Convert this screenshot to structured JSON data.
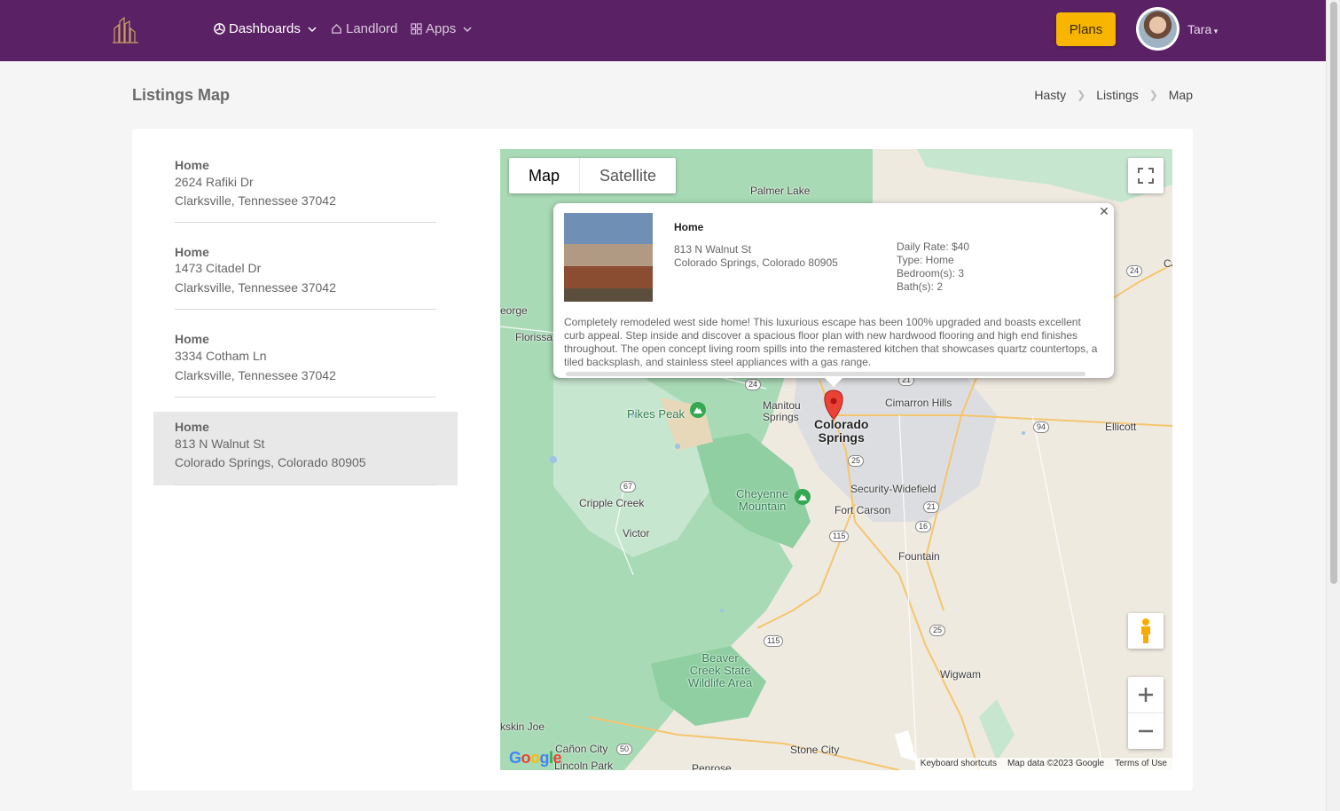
{
  "nav": {
    "dashboards": "Dashboards",
    "landlord": "Landlord",
    "apps": "Apps",
    "plans": "Plans",
    "user": "Tara"
  },
  "page": {
    "title": "Listings Map",
    "breadcrumb": [
      "Hasty",
      "Listings",
      "Map"
    ]
  },
  "listings": [
    {
      "title": "Home",
      "street": "2624 Rafiki Dr",
      "city": "Clarksville, Tennessee 37042"
    },
    {
      "title": "Home",
      "street": "1473 Citadel Dr",
      "city": "Clarksville, Tennessee 37042"
    },
    {
      "title": "Home",
      "street": "3334 Cotham Ln",
      "city": "Clarksville, Tennessee 37042"
    },
    {
      "title": "Home",
      "street": "813 N Walnut St",
      "city": "Colorado Springs, Colorado 80905"
    }
  ],
  "map": {
    "type_map": "Map",
    "type_satellite": "Satellite",
    "labels": {
      "palmer_lake": "Palmer Lake",
      "george": "eorge",
      "florissant": "Florissa",
      "pikes_peak": "Pikes Peak",
      "manitou": "Manitou\nSprings",
      "colorado_springs": "Colorado\nSprings",
      "cimarron_hills": "Cimarron Hills",
      "ellicott": "Ellicott",
      "security_widefield": "Security-Widefield",
      "fort_carson": "Fort Carson",
      "cheyenne_mountain": "Cheyenne\nMountain",
      "cripple_creek": "Cripple Creek",
      "victor": "Victor",
      "fountain": "Fountain",
      "beaver_creek": "Beaver\nCreek State\nWildlife Area",
      "wigwam": "Wigwam",
      "penrose": "Penrose",
      "stone_city": "Stone City",
      "canon_city": "Cañon City",
      "lincoln_park": "Lincoln Park",
      "buckskin_joe": "kskin Joe",
      "calhan": "Ca"
    },
    "shields": [
      "24",
      "24",
      "21",
      "94",
      "25",
      "67",
      "21",
      "16",
      "115",
      "25",
      "115",
      "50",
      "24"
    ],
    "attribution": {
      "shortcuts": "Keyboard shortcuts",
      "data": "Map data ©2023 Google",
      "terms": "Terms of Use"
    },
    "logo": "Google"
  },
  "info_window": {
    "title": "Home",
    "street": "813 N Walnut St",
    "city": "Colorado Springs, Colorado 80905",
    "daily_rate": "Daily Rate: $40",
    "type": "Type: Home",
    "bedrooms": "Bedroom(s): 3",
    "baths": "Bath(s): 2",
    "description": "Completely remodeled west side home! This luxurious escape has been 100% upgraded and boasts excellent curb appeal. Step inside and discover a spacious floor plan with new hardwood flooring and high end finishes throughout. The open concept living room spills into the remastered kitchen that showcases quartz countertops, a tiled backsplash, and stainless steel appliances with a gas range."
  },
  "colors": {
    "nav_bg": "#5b2165",
    "plans_bg": "#f7b500",
    "marker": "#ea4335",
    "park": "#a8dab5"
  }
}
